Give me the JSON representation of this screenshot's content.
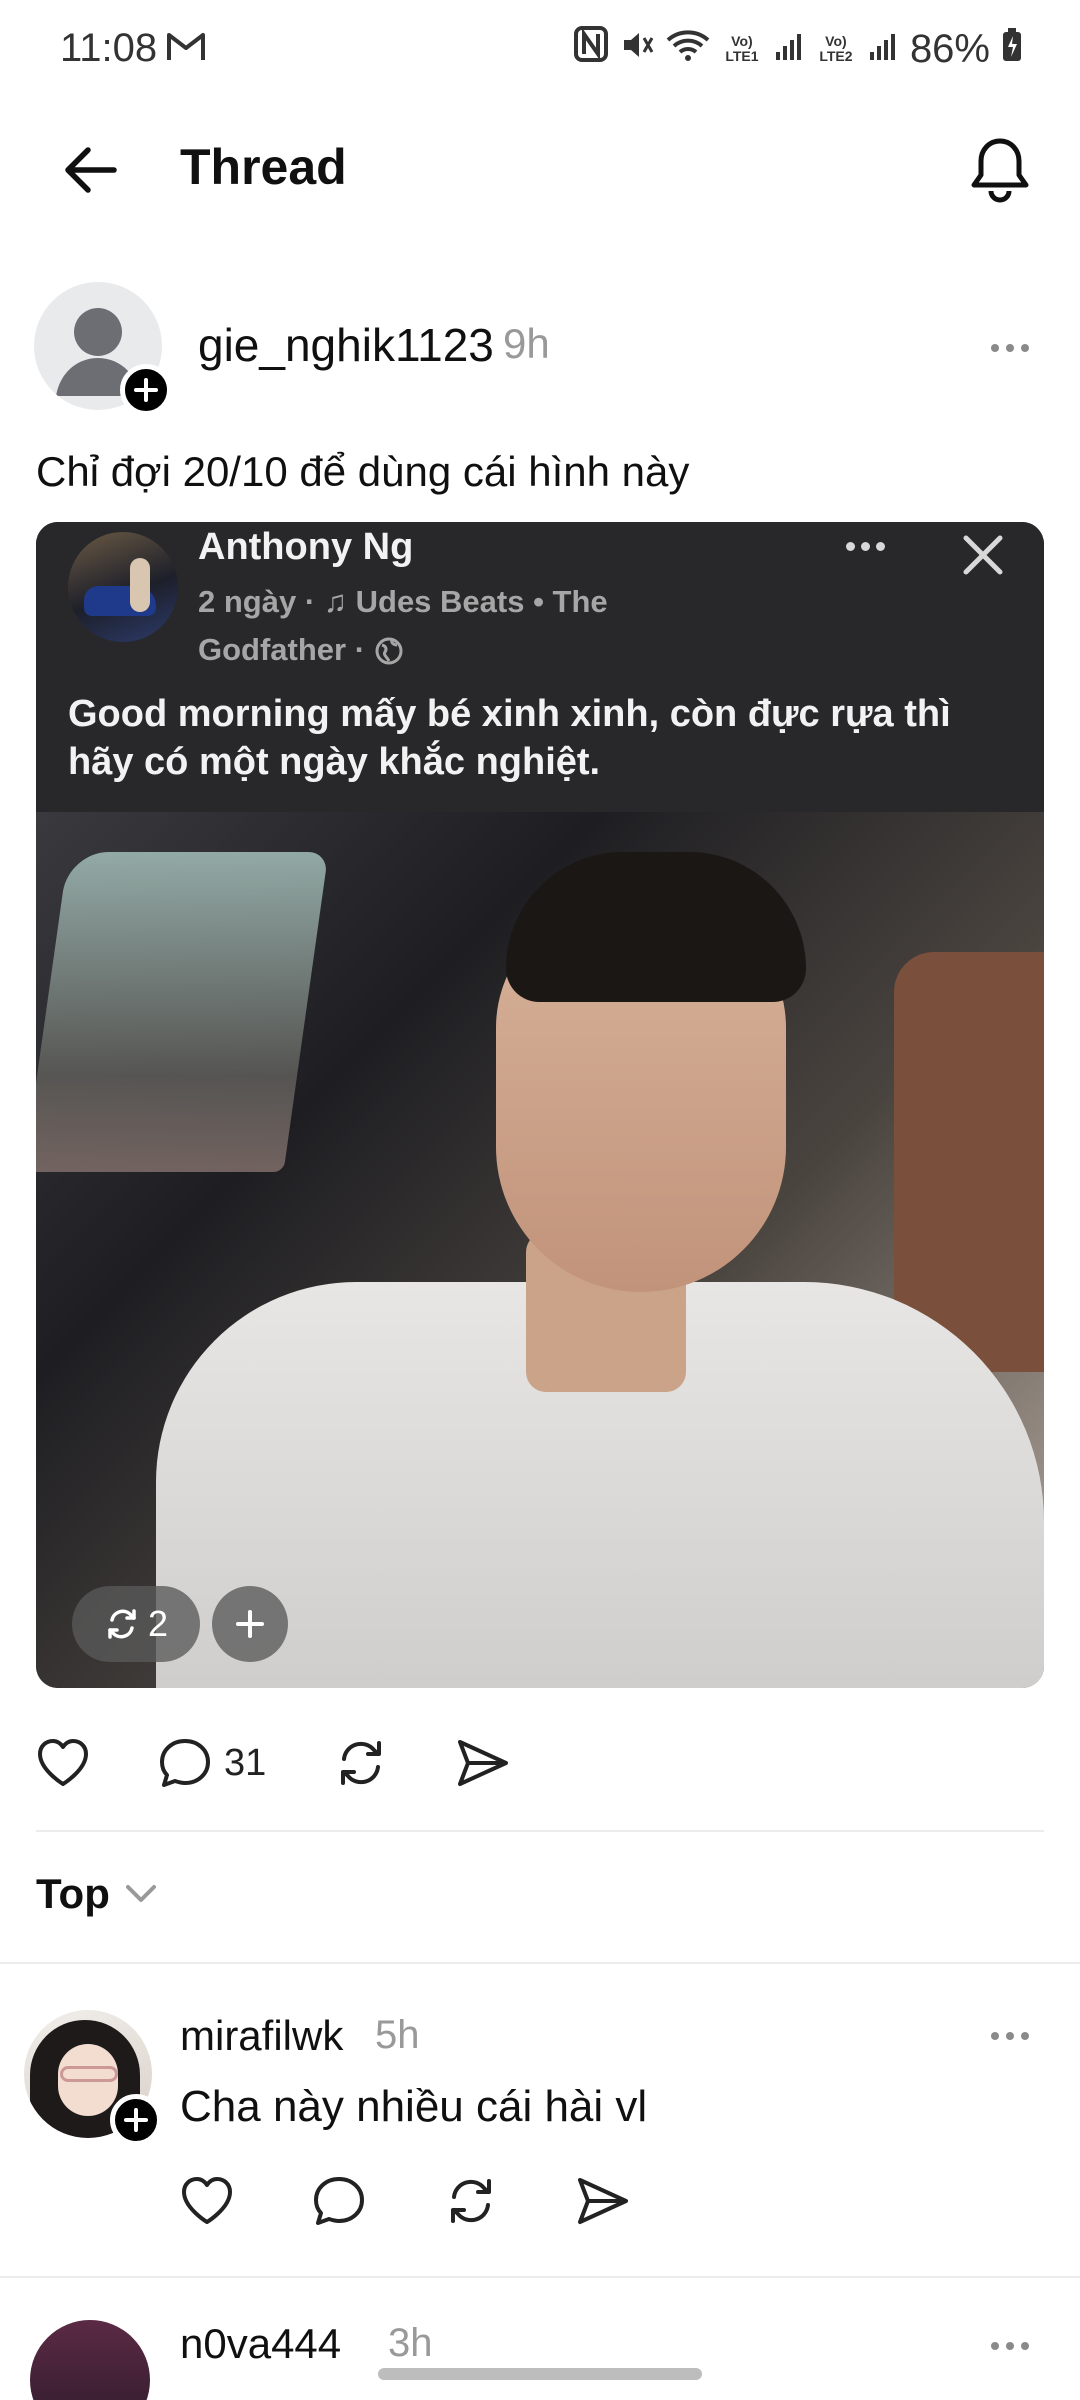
{
  "status_bar": {
    "time": "11:08",
    "battery_percent": "86%",
    "sim1_label": "Vo) LTE1",
    "sim2_label": "Vo) LTE2"
  },
  "header": {
    "title": "Thread"
  },
  "post": {
    "author": "gie_nghik1123",
    "time": "9h",
    "text": "Chỉ đợi 20/10 để dùng cái hình này",
    "embed": {
      "name": "Anthony Ng",
      "meta": "2 ngày · ♫ Udes Beats • The Godfather ·",
      "caption": "Good morning mấy bé xinh xinh, còn đực rựa thì hãy có một ngày khắc nghiệt.",
      "repost_count": "2"
    },
    "reply_count": "31"
  },
  "sort": {
    "label": "Top"
  },
  "replies": [
    {
      "author": "mirafilwk",
      "time": "5h",
      "text": "Cha này nhiều cái hài vl"
    },
    {
      "author": "n0va444",
      "time": "3h"
    }
  ],
  "colors": {
    "text": "#101010",
    "muted": "#999999",
    "divider": "#ececec",
    "embed_bg": "#28282a"
  }
}
